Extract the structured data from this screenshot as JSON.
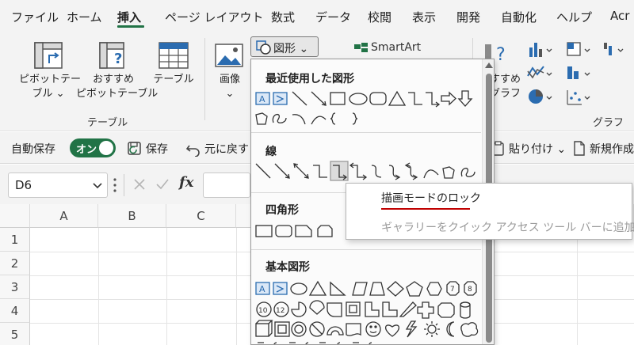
{
  "tabs": [
    {
      "label": "ファイル",
      "active": false
    },
    {
      "label": "ホーム",
      "active": false
    },
    {
      "label": "挿入",
      "active": true
    },
    {
      "label": "ページ レイアウト",
      "active": false
    },
    {
      "label": "数式",
      "active": false
    },
    {
      "label": "データ",
      "active": false
    },
    {
      "label": "校閲",
      "active": false
    },
    {
      "label": "表示",
      "active": false
    },
    {
      "label": "開発",
      "active": false
    },
    {
      "label": "自動化",
      "active": false
    },
    {
      "label": "ヘルプ",
      "active": false
    },
    {
      "label": "Acr",
      "active": false
    }
  ],
  "ribbon": {
    "pivot_line1": "ピボットテー",
    "pivot_line2": "ブル ⌄",
    "recommended_line1": "おすすめ",
    "recommended_line2": "ピボットテーブル",
    "table_label": "テーブル",
    "tables_group": "テーブル",
    "image_label": "画像",
    "image_chevron": "⌄",
    "shapes_button": "図形 ⌄",
    "smartart_label": "SmartArt",
    "rec_chart_line1": "すすめ",
    "rec_chart_line2": "グラフ",
    "charts_group": "グラフ"
  },
  "qat": {
    "autosave_label": "自動保存",
    "autosave_state": "オン",
    "save_label": "保存",
    "undo_label": "元に戻す",
    "paste_label": "貼り付け ⌄",
    "new_label": "新規作成"
  },
  "formula_bar": {
    "name_box_value": "D6",
    "fx_label": "fx"
  },
  "grid": {
    "columns": [
      "A",
      "B",
      "C"
    ],
    "rows": [
      "1",
      "2",
      "3",
      "4",
      "5"
    ]
  },
  "gallery": {
    "sections": [
      "最近使用した図形",
      "線",
      "四角形",
      "基本図形"
    ]
  },
  "context_menu": {
    "items": [
      {
        "label": "描画モードのロック",
        "enabled": true
      },
      {
        "label": "ギャラリーをクイック アクセス ツール バーに追加(A)",
        "enabled": false
      }
    ]
  },
  "colors": {
    "accent": "#217346",
    "highlight_underline": "#c00000",
    "shape_highlight": "#2b6cb0"
  }
}
